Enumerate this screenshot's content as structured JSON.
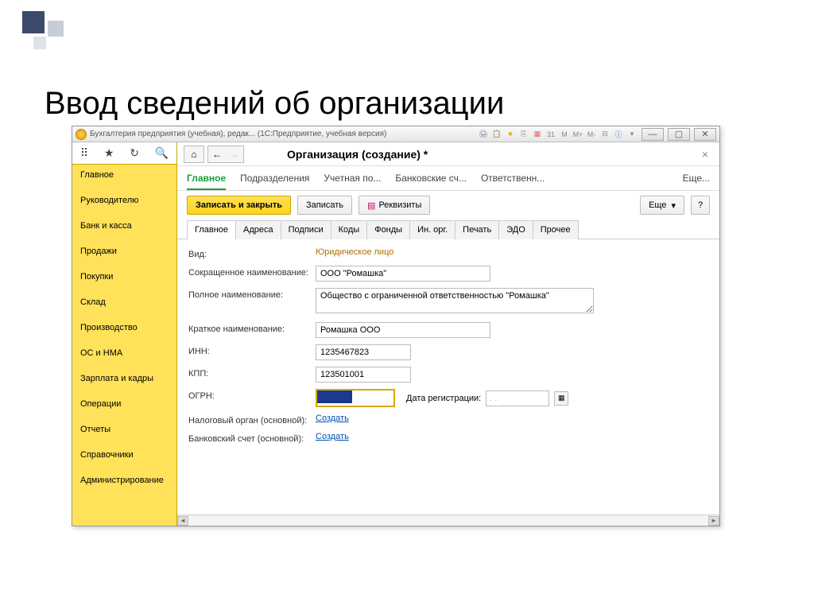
{
  "slide": {
    "title": "Ввод сведений об организации"
  },
  "titlebar": {
    "text": "Бухгалтерия предприятия (учебная), редак...  (1С:Предприятие, учебная версия)",
    "m_buttons": [
      "M",
      "M+",
      "M-"
    ]
  },
  "sidebar": {
    "items": [
      "Главное",
      "Руководителю",
      "Банк и касса",
      "Продажи",
      "Покупки",
      "Склад",
      "Производство",
      "ОС и НМА",
      "Зарплата и кадры",
      "Операции",
      "Отчеты",
      "Справочники",
      "Администрирование"
    ]
  },
  "page": {
    "title": "Организация (создание) *"
  },
  "subtabs": {
    "items": [
      "Главное",
      "Подразделения",
      "Учетная по...",
      "Банковские сч...",
      "Ответственн..."
    ],
    "more": "Еще..."
  },
  "actions": {
    "save_close": "Записать и закрыть",
    "save": "Записать",
    "requisites": "Реквизиты",
    "more": "Еще",
    "help": "?"
  },
  "formtabs": [
    "Главное",
    "Адреса",
    "Подписи",
    "Коды",
    "Фонды",
    "Ин. орг.",
    "Печать",
    "ЭДО",
    "Прочее"
  ],
  "form": {
    "type_label": "Вид:",
    "type_value": "Юридическое лицо",
    "short_label": "Сокращенное наименование:",
    "short_value": "ООО \"Ромашка\"",
    "full_label": "Полное наименование:",
    "full_value": "Общество с ограниченной ответственностью \"Ромашка\"",
    "brief_label": "Краткое наименование:",
    "brief_value": "Ромашка ООО",
    "inn_label": "ИНН:",
    "inn_value": "1235467823",
    "kpp_label": "КПП:",
    "kpp_value": "123501001",
    "ogrn_label": "ОГРН:",
    "regdate_label": "Дата регистрации:",
    "regdate_value": " .  .",
    "tax_label": "Налоговый орган (основной):",
    "bank_label": "Банковский счет (основной):",
    "create_link": "Создать"
  }
}
